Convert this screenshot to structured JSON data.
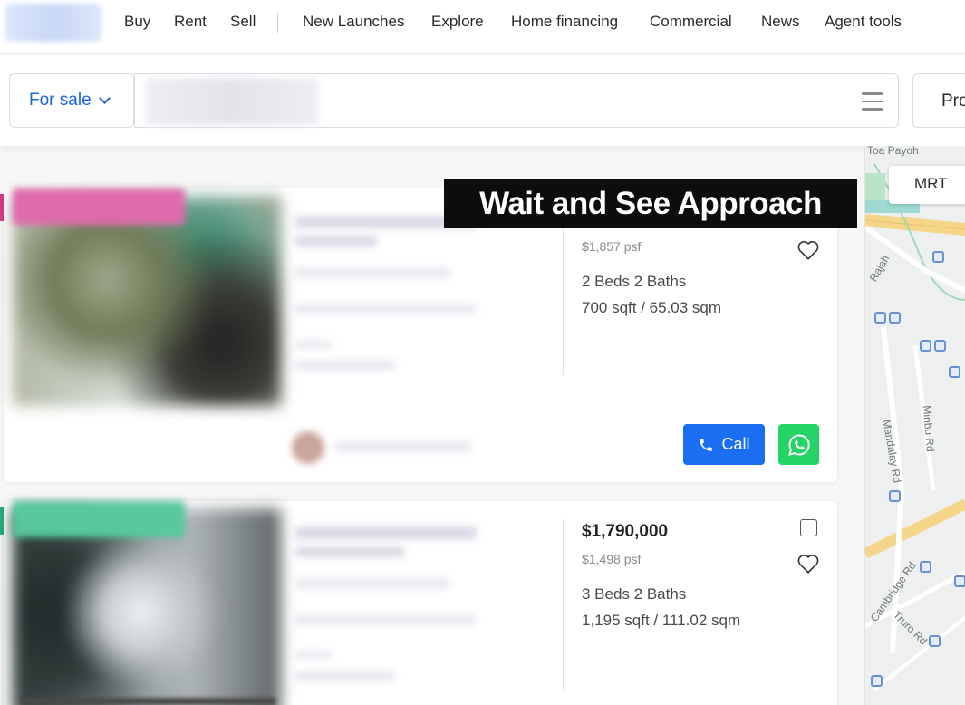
{
  "nav": {
    "items": [
      "Buy",
      "Rent",
      "Sell",
      "New Launches",
      "Explore",
      "Home financing",
      "Commercial",
      "News",
      "Agent tools"
    ]
  },
  "search": {
    "mode_label": "For sale",
    "right_button_label": "Pro"
  },
  "map": {
    "labels": [
      "Toa Payoh",
      "Rajah",
      "Mandalay Rd",
      "Minbu Rd",
      "Cambridge Rd",
      "Truro Rd"
    ],
    "mrt_button": "MRT"
  },
  "overlay": {
    "caption": "Wait and See Approach"
  },
  "listings": [
    {
      "price": "",
      "psf": "$1,857 psf",
      "beds_baths": "2 Beds   2 Baths",
      "area": "700 sqft / 65.03 sqm",
      "call_label": "Call",
      "ribbon_color": "#e06aae"
    },
    {
      "price": "$1,790,000",
      "psf": "$1,498 psf",
      "beds_baths": "3 Beds   2 Baths",
      "area": "1,195 sqft / 111.02 sqm",
      "ribbon_color": "#57c99c"
    }
  ],
  "colors": {
    "accent": "#1d64d8",
    "call_button": "#1b6ef2",
    "whatsapp": "#25d366"
  }
}
